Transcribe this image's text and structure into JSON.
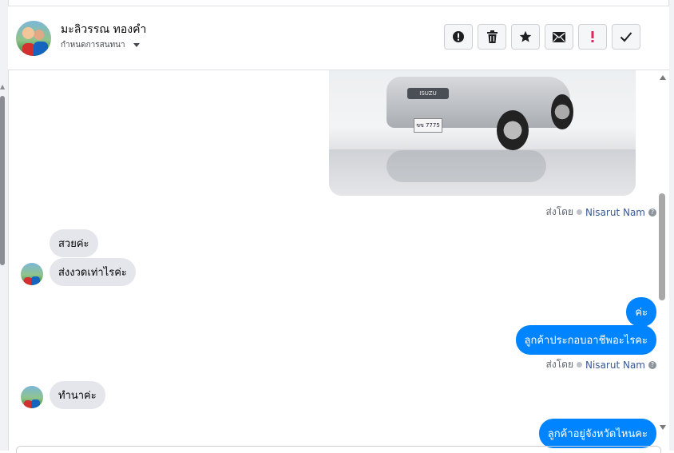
{
  "header": {
    "contact_name": "มะลิวรรณ ทองคำ",
    "assign_label": "กำหนดการสนทนา",
    "actions": [
      {
        "name": "mark-spam",
        "icon": "exclamation-circle-icon"
      },
      {
        "name": "delete",
        "icon": "trash-icon"
      },
      {
        "name": "star",
        "icon": "star-icon"
      },
      {
        "name": "mark-unread",
        "icon": "envelope-icon"
      },
      {
        "name": "follow-up",
        "icon": "exclamation-icon"
      },
      {
        "name": "mark-done",
        "icon": "check-icon"
      }
    ]
  },
  "messages": {
    "sent_by_prefix": "ส่งโดย",
    "sent_by_name": "Nisarut Nam",
    "in_1": "สวยค่ะ",
    "in_2": "ส่งงวดเท่าไรค่ะ",
    "out_1": "ค่ะ",
    "out_2": "ลูกค้าประกอบอาชีพอะไรคะ",
    "in_3": "ทำนาค่ะ",
    "out_3": "ลูกค้าอยู่จังหวัดไหนคะ",
    "photo_brand_text": "ISUZU",
    "photo_plate_text": "ขข 7775"
  },
  "colors": {
    "outgoing_bubble": "#0084ff",
    "incoming_bubble": "#e4e6eb",
    "follow_up_accent": "#e0245e"
  }
}
